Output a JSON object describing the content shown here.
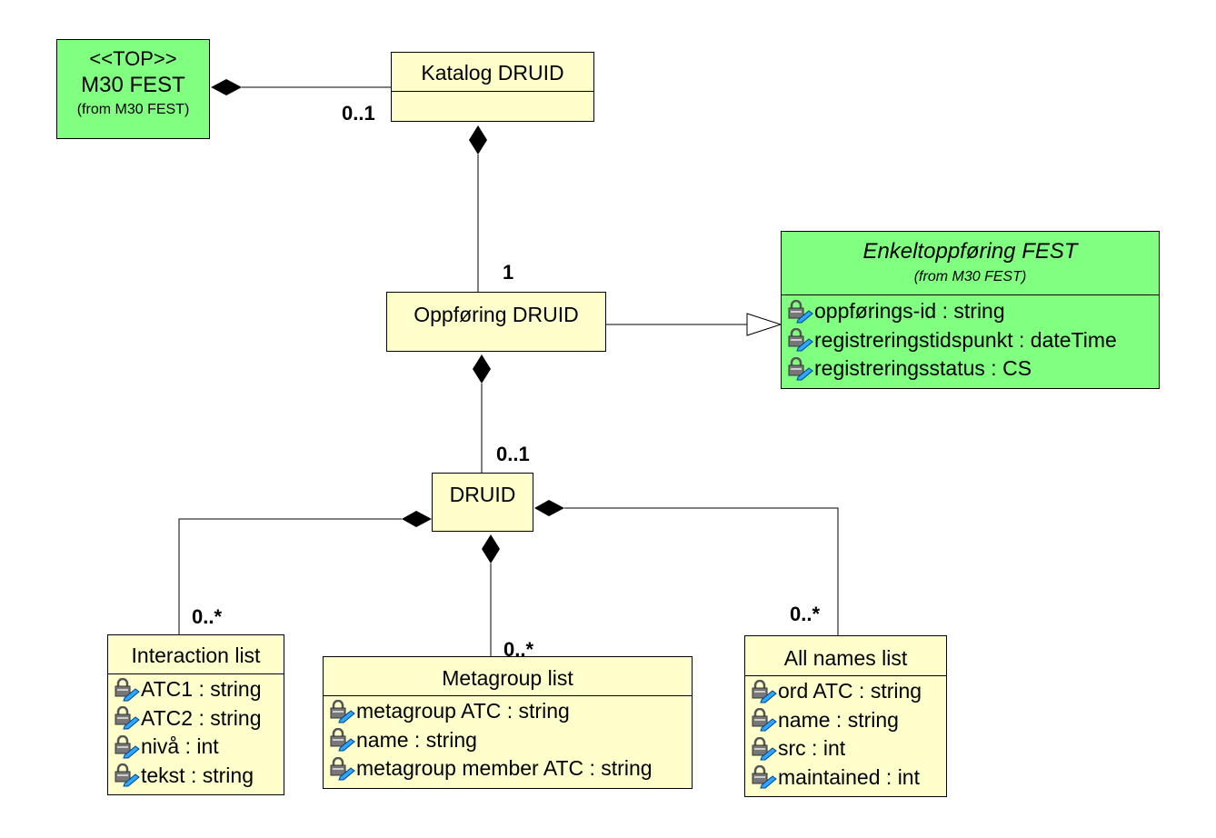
{
  "colors": {
    "package_class": "#80ff80",
    "class": "#ffffcc"
  },
  "attribute_icon": "private-attribute-lock-icon",
  "classes": {
    "m30": {
      "stereotype": "<<TOP>>",
      "name": "M30 FEST",
      "from": "(from M30 FEST)"
    },
    "katalog": {
      "name": "Katalog DRUID"
    },
    "oppforing": {
      "name": "Oppføring DRUID"
    },
    "enkelt": {
      "name": "Enkeltoppføring FEST",
      "from": "(from M30 FEST)",
      "attributes": [
        "oppførings-id : string",
        "registreringstidspunkt : dateTime",
        "registreringsstatus : CS"
      ]
    },
    "druid": {
      "name": "DRUID"
    },
    "interaction": {
      "name": "Interaction list",
      "attributes": [
        "ATC1 : string",
        "ATC2 : string",
        "nivå : int",
        "tekst : string"
      ]
    },
    "metagroup": {
      "name": "Metagroup list",
      "attributes": [
        "metagroup ATC : string",
        "name : string",
        "metagroup member ATC : string"
      ]
    },
    "allnames": {
      "name": "All names list",
      "attributes": [
        "ord ATC : string",
        "name : string",
        "src : int",
        "maintained : int"
      ]
    }
  },
  "multiplicities": {
    "katalog_m30": "0..1",
    "oppforing_katalog": "1",
    "druid_oppforing": "0..1",
    "interaction": "0..*",
    "metagroup": "0..*",
    "allnames": "0..*"
  }
}
